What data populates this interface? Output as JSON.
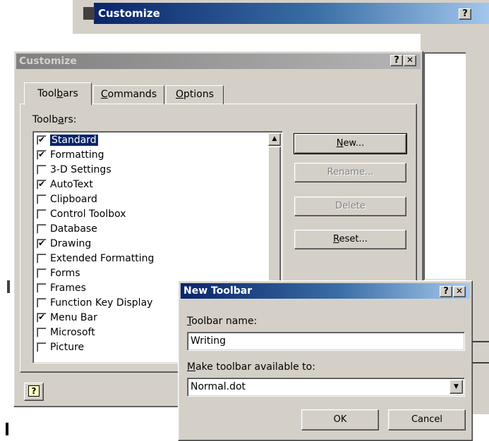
{
  "back_window": {
    "title": "Customize",
    "help": "?"
  },
  "customize": {
    "title": "Customize",
    "help": "?",
    "close": "✕",
    "tabs": [
      {
        "pre": "Tool",
        "u": "b",
        "post": "ars"
      },
      {
        "pre": "",
        "u": "C",
        "post": "ommands"
      },
      {
        "pre": "",
        "u": "O",
        "post": "ptions"
      }
    ],
    "list_label_pre": "Toolb",
    "list_label_u": "a",
    "list_label_post": "rs:",
    "toolbars": [
      {
        "label": "Standard",
        "checked": true,
        "selected": true
      },
      {
        "label": "Formatting",
        "checked": true
      },
      {
        "label": "3-D Settings",
        "checked": false
      },
      {
        "label": "AutoText",
        "checked": true
      },
      {
        "label": "Clipboard",
        "checked": false
      },
      {
        "label": "Control Toolbox",
        "checked": false
      },
      {
        "label": "Database",
        "checked": false
      },
      {
        "label": "Drawing",
        "checked": true
      },
      {
        "label": "Extended Formatting",
        "checked": false
      },
      {
        "label": "Forms",
        "checked": false
      },
      {
        "label": "Frames",
        "checked": false
      },
      {
        "label": "Function Key Display",
        "checked": false
      },
      {
        "label": "Menu Bar",
        "checked": true
      },
      {
        "label": "Microsoft",
        "checked": false
      },
      {
        "label": "Picture",
        "checked": false
      }
    ],
    "buttons": {
      "new_u": "N",
      "new_post": "ew...",
      "rename": "Rename...",
      "delete": "Delete",
      "reset_u": "R",
      "reset_post": "eset..."
    },
    "help_icon": "help-icon"
  },
  "new_toolbar": {
    "title": "New Toolbar",
    "help": "?",
    "close": "✕",
    "name_label_u": "T",
    "name_label_post": "oolbar name:",
    "name_value": "Writing",
    "avail_label_u": "M",
    "avail_label_post": "ake toolbar available to:",
    "avail_value": "Normal.dot",
    "ok": "OK",
    "cancel": "Cancel"
  },
  "colors": {
    "title_active": "#0a246a",
    "face": "#d4d0c8",
    "selection": "#0a246a"
  }
}
